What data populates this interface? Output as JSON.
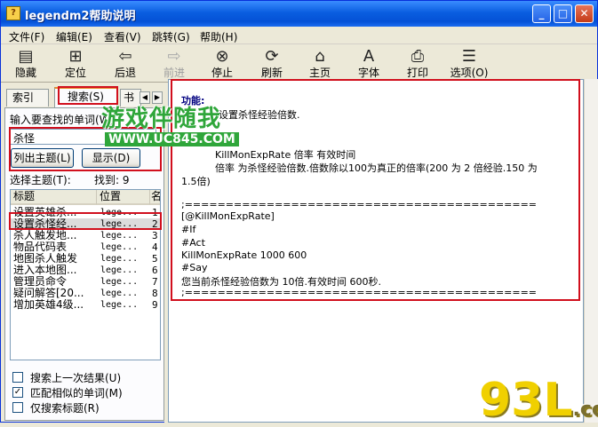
{
  "window": {
    "title": "legendm2帮助说明",
    "controls": [
      "_",
      "□",
      "✕"
    ]
  },
  "menu": [
    "文件(F)",
    "编辑(E)",
    "查看(V)",
    "跳转(G)",
    "帮助(H)"
  ],
  "toolbar": [
    {
      "label": "隐藏",
      "icon": "hide-icon",
      "glyph": "▤",
      "enabled": true
    },
    {
      "label": "定位",
      "icon": "locate-icon",
      "glyph": "⊞",
      "enabled": true
    },
    {
      "label": "后退",
      "icon": "back-arrow-icon",
      "glyph": "⇦",
      "enabled": true
    },
    {
      "label": "前进",
      "icon": "forward-arrow-icon",
      "glyph": "⇨",
      "enabled": false
    },
    {
      "label": "停止",
      "icon": "stop-icon",
      "glyph": "⊗",
      "enabled": true
    },
    {
      "label": "刷新",
      "icon": "refresh-icon",
      "glyph": "⟳",
      "enabled": true
    },
    {
      "label": "主页",
      "icon": "home-icon",
      "glyph": "⌂",
      "enabled": true
    },
    {
      "label": "字体",
      "icon": "font-icon",
      "glyph": "A",
      "enabled": true
    },
    {
      "label": "打印",
      "icon": "print-icon",
      "glyph": "⎙",
      "enabled": true
    },
    {
      "label": "选项(O)",
      "icon": "options-icon",
      "glyph": "☰",
      "enabled": true
    }
  ],
  "tabs": {
    "index": "索引(N)",
    "search": "搜索(S)",
    "bookmarks": "书"
  },
  "search": {
    "keyword_label": "输入要查找的单词(W)",
    "keyword_value": "杀怪",
    "list_topics_button": "列出主题(L)",
    "display_button": "显示(D)",
    "select_topic_label": "选择主题(T):",
    "found_label": "找到: 9"
  },
  "results": {
    "columns": [
      "标题",
      "位置",
      "名"
    ],
    "rows": [
      {
        "title": "设置英雄杀...",
        "location": "lege...",
        "rank": "1"
      },
      {
        "title": "设置杀怪经...",
        "location": "lege...",
        "rank": "2"
      },
      {
        "title": "杀人触发地...",
        "location": "lege...",
        "rank": "3"
      },
      {
        "title": "物品代码表",
        "location": "lege...",
        "rank": "4"
      },
      {
        "title": "地图杀人触发",
        "location": "lege...",
        "rank": "5"
      },
      {
        "title": "进入本地图...",
        "location": "lege...",
        "rank": "6"
      },
      {
        "title": "管理员命令",
        "location": "lege...",
        "rank": "7"
      },
      {
        "title": "疑问解答[20...",
        "location": "lege...",
        "rank": "8"
      },
      {
        "title": "增加英雄4级...",
        "location": "lege...",
        "rank": "9"
      }
    ],
    "selected_index": 1
  },
  "options": [
    {
      "label": "搜索上一次结果(U)",
      "checked": false
    },
    {
      "label": "匹配相似的单词(M)",
      "checked": true
    },
    {
      "label": "仅搜索标题(R)",
      "checked": false
    }
  ],
  "content": {
    "func_label": "功能:",
    "func_desc": "设置杀怪经验倍数.",
    "syntax": "KillMonExpRate 倍率 有效时间",
    "param_line1": "倍率 为杀怪经验倍数.倍数除以100为真正的倍率(200 为 2 倍经验.150 为",
    "param_line2": "1.5倍)",
    "sep1": ";===========================================",
    "script_lines": [
      "[@KillMonExpRate]",
      "#If",
      "#Act",
      "KillMonExpRate 1000 600",
      "#Say"
    ],
    "say_line": "您当前杀怪经验倍数为 10倍.有效时间 600秒.",
    "sep2": ";==========================================="
  },
  "watermarks": {
    "site_name": "游戏伴随我",
    "site_url": "WWW.UC845.COM",
    "logo": "93L",
    "logo_suffix": ".com"
  }
}
